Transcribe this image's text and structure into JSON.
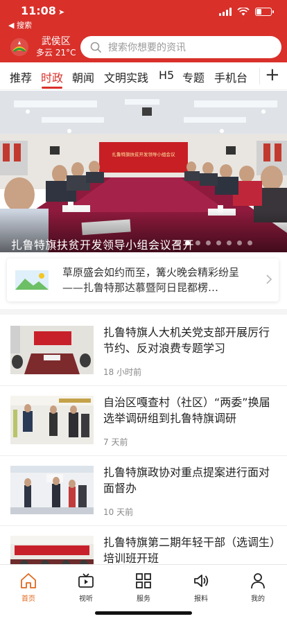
{
  "status_bar": {
    "time": "11:08",
    "back_label": "◀ 搜索",
    "battery_level": 0.35
  },
  "header": {
    "logo_icon": "grassland-emblem-icon",
    "district": "武侯区",
    "weather": "多云 21°C",
    "search_placeholder": "搜索你想要的资讯"
  },
  "tabs": {
    "items": [
      {
        "label": "推荐"
      },
      {
        "label": "时政",
        "active": true
      },
      {
        "label": "朝闻"
      },
      {
        "label": "文明实践"
      },
      {
        "label": "H5"
      },
      {
        "label": "专题"
      },
      {
        "label": "手机台"
      }
    ],
    "add_icon": "plus-icon"
  },
  "hero": {
    "caption": "扎鲁特旗扶贫开发领导小组会议召开",
    "banner_text": "扎鲁特旗扶贫开发领导小组会议",
    "slide_count": 8,
    "active_slide": 1
  },
  "promo": {
    "text": "草原盛会如约而至，篝火晚会精彩纷呈 ——扎鲁特那达慕暨阿日昆都楞…"
  },
  "news": [
    {
      "title": "扎鲁特旗人大机关党支部开展厉行节约、反对浪费专题学习",
      "time": "18 小时前"
    },
    {
      "title": "自治区嘎查村（社区）“两委”换届选举调研组到扎鲁特旗调研",
      "time": "7 天前"
    },
    {
      "title": "扎鲁特旗政协对重点提案进行面对面督办",
      "time": "10 天前"
    },
    {
      "title": "扎鲁特旗第二期年轻干部（选调生）培训班开班",
      "time": ""
    }
  ],
  "bottom_nav": [
    {
      "label": "首页",
      "icon": "home-icon",
      "active": true
    },
    {
      "label": "视听",
      "icon": "video-icon"
    },
    {
      "label": "服务",
      "icon": "grid-icon"
    },
    {
      "label": "报料",
      "icon": "speaker-icon"
    },
    {
      "label": "我的",
      "icon": "person-icon"
    }
  ],
  "colors": {
    "brand_red": "#d9302a",
    "active_nav": "#e0681f"
  }
}
